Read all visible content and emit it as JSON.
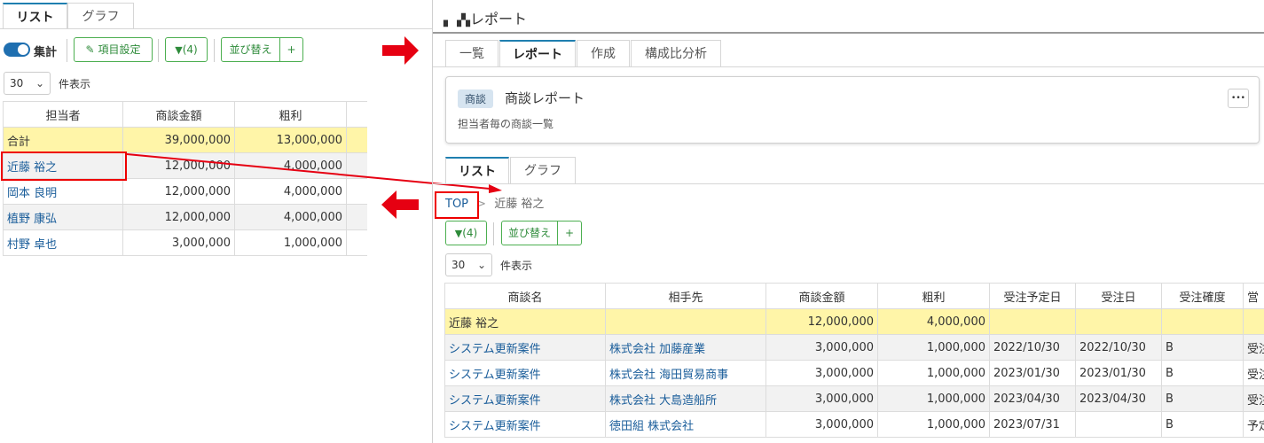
{
  "left": {
    "tabs": [
      {
        "label": "リスト"
      },
      {
        "label": "グラフ"
      }
    ],
    "toggle_label": "集計",
    "item_settings_label": "項目設定",
    "filter_label": "(4)",
    "sort_label": "並び替え",
    "plus_label": "+",
    "per_page_value": "30",
    "per_page_suffix": "件表示",
    "columns": [
      "担当者",
      "商談金額",
      "粗利"
    ],
    "total": {
      "name": "合計",
      "amount": "39,000,000",
      "profit": "13,000,000"
    },
    "rows": [
      {
        "name": "近藤 裕之",
        "amount": "12,000,000",
        "profit": "4,000,000"
      },
      {
        "name": "岡本 良明",
        "amount": "12,000,000",
        "profit": "4,000,000"
      },
      {
        "name": "植野 康弘",
        "amount": "12,000,000",
        "profit": "4,000,000"
      },
      {
        "name": "村野 卓也",
        "amount": "3,000,000",
        "profit": "1,000,000"
      }
    ]
  },
  "right": {
    "title": "レポート",
    "top_tabs": [
      {
        "label": "一覧"
      },
      {
        "label": "レポート"
      },
      {
        "label": "作成"
      },
      {
        "label": "構成比分析"
      }
    ],
    "report": {
      "badge": "商談",
      "name": "商談レポート",
      "description": "担当者毎の商談一覧",
      "more_label": "•••"
    },
    "sub_tabs": [
      {
        "label": "リスト"
      },
      {
        "label": "グラフ"
      }
    ],
    "breadcrumb": {
      "top": "TOP",
      "separator": ">",
      "current": "近藤 裕之"
    },
    "filter_label": "(4)",
    "sort_label": "並び替え",
    "plus_label": "+",
    "per_page_value": "30",
    "per_page_suffix": "件表示",
    "columns": [
      "商談名",
      "相手先",
      "商談金額",
      "粗利",
      "受注予定日",
      "受注日",
      "受注確度",
      "営"
    ],
    "total": {
      "name": "近藤 裕之",
      "amount": "12,000,000",
      "profit": "4,000,000"
    },
    "rows": [
      {
        "name": "システム更新案件",
        "client": "株式会社 加藤産業",
        "amount": "3,000,000",
        "profit": "1,000,000",
        "plan": "2022/10/30",
        "date": "2022/10/30",
        "rank": "B",
        "extra": "受注"
      },
      {
        "name": "システム更新案件",
        "client": "株式会社 海田貿易商事",
        "amount": "3,000,000",
        "profit": "1,000,000",
        "plan": "2023/01/30",
        "date": "2023/01/30",
        "rank": "B",
        "extra": "受注"
      },
      {
        "name": "システム更新案件",
        "client": "株式会社 大島造船所",
        "amount": "3,000,000",
        "profit": "1,000,000",
        "plan": "2023/04/30",
        "date": "2023/04/30",
        "rank": "B",
        "extra": "受注"
      },
      {
        "name": "システム更新案件",
        "client": "徳田組 株式会社",
        "amount": "3,000,000",
        "profit": "1,000,000",
        "plan": "2023/07/31",
        "date": "",
        "rank": "B",
        "extra": "予定"
      }
    ]
  }
}
